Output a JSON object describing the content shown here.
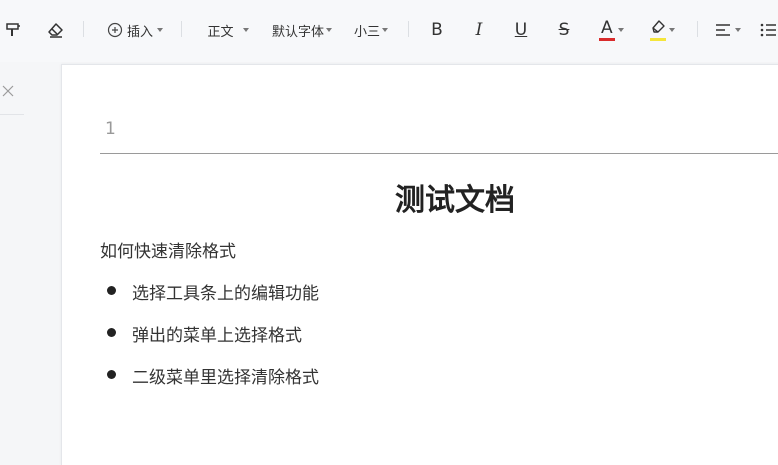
{
  "toolbar": {
    "insert_label": "插入",
    "style_label": "正文",
    "font_label": "默认字体",
    "size_label": "小三",
    "bold_label": "B",
    "italic_label": "I",
    "underline_label": "U",
    "strike_label": "S",
    "font_color_label": "A",
    "font_color": "#d92b2b",
    "highlight_color": "#f5e63b"
  },
  "document": {
    "header_text": "1",
    "title": "测试文档",
    "intro": "如何快速清除格式",
    "bullets": [
      "选择工具条上的编辑功能",
      "弹出的菜单上选择格式",
      "二级菜单里选择清除格式"
    ]
  }
}
